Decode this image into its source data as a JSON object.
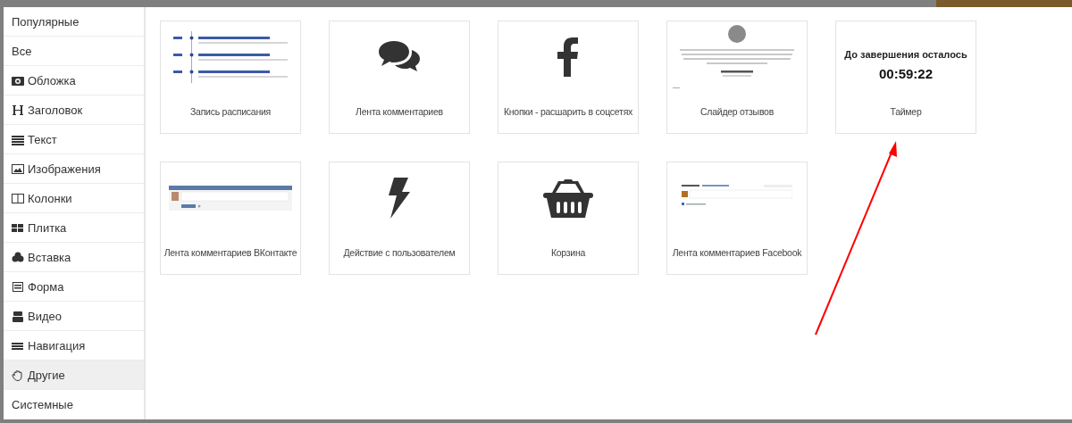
{
  "sidebar": {
    "items": [
      {
        "label": "Популярные",
        "selected": false
      },
      {
        "label": "Все",
        "selected": false
      },
      {
        "label": "Обложка",
        "selected": false
      },
      {
        "label": "Заголовок",
        "selected": false
      },
      {
        "label": "Текст",
        "selected": false
      },
      {
        "label": "Изображения",
        "selected": false
      },
      {
        "label": "Колонки",
        "selected": false
      },
      {
        "label": "Плитка",
        "selected": false
      },
      {
        "label": "Вставка",
        "selected": false
      },
      {
        "label": "Форма",
        "selected": false
      },
      {
        "label": "Видео",
        "selected": false
      },
      {
        "label": "Навигация",
        "selected": false
      },
      {
        "label": "Другие",
        "selected": true
      },
      {
        "label": "Системные",
        "selected": false
      }
    ]
  },
  "blocks": [
    {
      "kind": "schedule",
      "label": "Запись расписания"
    },
    {
      "kind": "comments",
      "label": "Лента комментариев"
    },
    {
      "kind": "facebook",
      "label": "Кнопки - расшарить в соцсетях"
    },
    {
      "kind": "reviews",
      "label": "Слайдер отзывов"
    },
    {
      "kind": "timer",
      "label": "Таймер",
      "heading": "До завершения осталось",
      "time": "00:59:22"
    },
    {
      "kind": "vk",
      "label": "Лента комментариев ВКонтакте"
    },
    {
      "kind": "lightning",
      "label": "Действие с пользователем"
    },
    {
      "kind": "basket",
      "label": "Корзина"
    },
    {
      "kind": "fbcomments",
      "label": "Лента комментариев Facebook"
    }
  ]
}
